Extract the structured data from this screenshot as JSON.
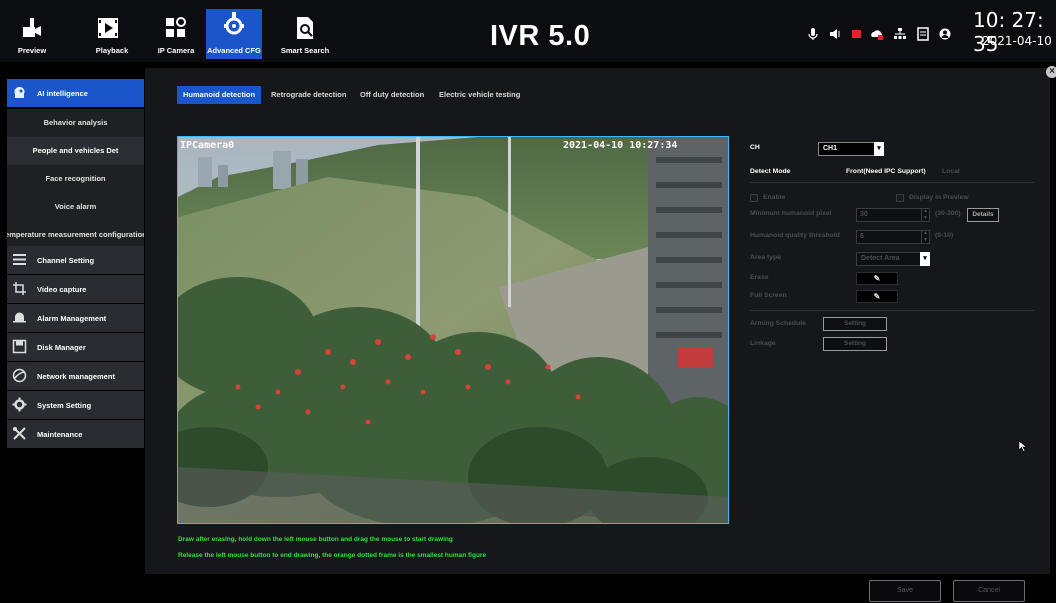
{
  "nav": {
    "items": [
      {
        "label": "Preview",
        "icon": "preview-icon"
      },
      {
        "label": "Playback",
        "icon": "playback-icon"
      },
      {
        "label": "IP Camera",
        "icon": "ip-camera-icon"
      },
      {
        "label": "Advanced CFG",
        "icon": "advanced-cfg-icon",
        "active": true
      },
      {
        "label": "Smart Search",
        "icon": "smart-search-icon"
      }
    ]
  },
  "app_title": "IVR 5.0",
  "status_icons": [
    "microphone-icon",
    "speaker-icon",
    "record-icon",
    "cloud-icon",
    "network-icon",
    "hdd-icon",
    "user-icon"
  ],
  "clock": {
    "time": "10: 27: 35",
    "date": "2021-04-10"
  },
  "sidebar": {
    "ai": {
      "label": "AI intelligence",
      "icon": "ai-head-icon"
    },
    "sub_items": [
      "Behavior analysis",
      "People and vehicles Det",
      "Face recognition",
      "Voice alarm",
      "Temperature measurement configuration"
    ],
    "sections": [
      {
        "label": "Channel Setting",
        "icon": "channel-setting-icon"
      },
      {
        "label": "Video capture",
        "icon": "video-capture-icon"
      },
      {
        "label": "Alarm Management",
        "icon": "alarm-bell-icon"
      },
      {
        "label": "Disk Manager",
        "icon": "disk-icon"
      },
      {
        "label": "Network management",
        "icon": "globe-icon"
      },
      {
        "label": "System Setting",
        "icon": "gear-icon"
      },
      {
        "label": "Maintenance",
        "icon": "tools-icon"
      }
    ]
  },
  "tabs": [
    "Humanoid detection",
    "Retrograde detection",
    "Off duty detection",
    "Electric vehicle testing"
  ],
  "video": {
    "camera_name": "IPCamera0",
    "timestamp": "2021-04-10 10:27:34"
  },
  "hints": [
    "Draw after erasing, hold down the left mouse button and drag the mouse to start drawing",
    "Release the left mouse button to end drawing, the orange dotted frame is the smallest human figure"
  ],
  "form": {
    "ch_label": "CH",
    "ch_value": "CH1",
    "detect_mode_label": "Detect Mode",
    "detect_mode_value": "Front(Need IPC Support)",
    "detect_mode_extra": "Local",
    "enable_label": "Enable",
    "display_preview_label": "Display in Preview",
    "min_pixel_label": "Minimum humanoid pixel",
    "min_pixel_value": "30",
    "min_pixel_range": "(30-300)",
    "details_label": "Details",
    "quality_label": "Humanoid quality threshold",
    "quality_value": "6",
    "quality_range": "(0-10)",
    "area_type_label": "Area type",
    "area_type_value": "Detect Area",
    "erase_label": "Erase",
    "full_screen_label": "Full Screen",
    "arming_label": "Arming Schedule",
    "arming_button": "Setting",
    "linkage_label": "Linkage",
    "linkage_button": "Setting"
  },
  "footer": {
    "save": "Save",
    "cancel": "Cancel"
  }
}
